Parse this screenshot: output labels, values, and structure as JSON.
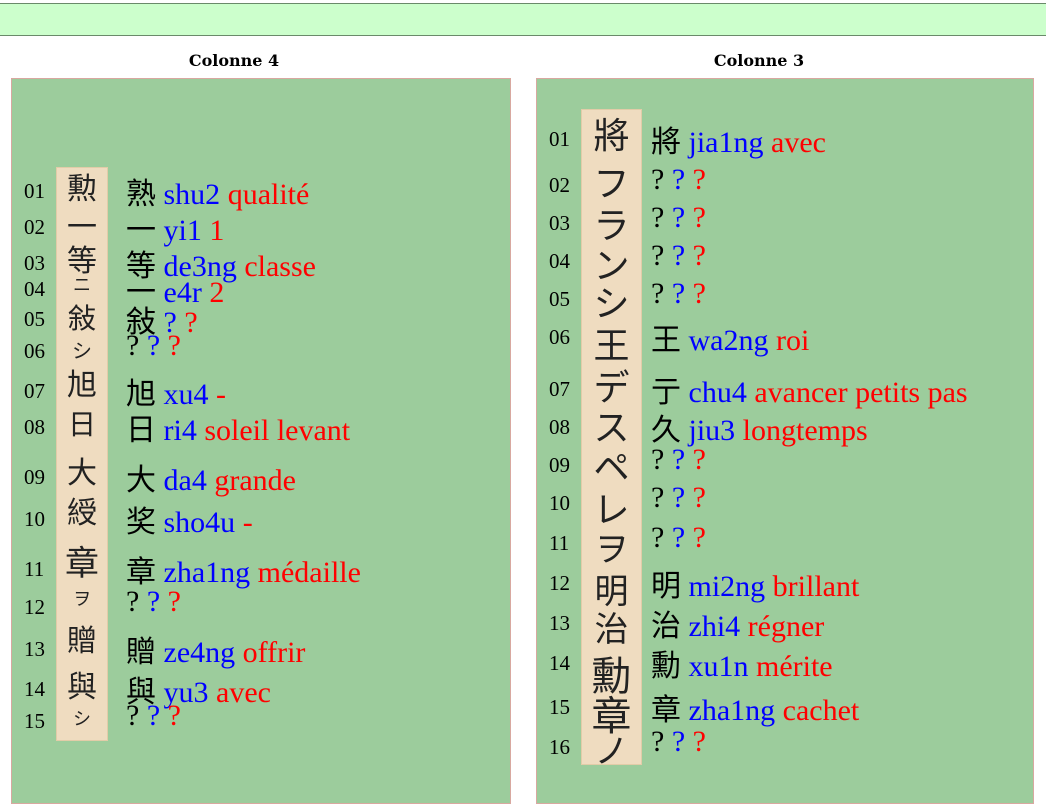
{
  "columns": [
    {
      "title": "Colonne 4",
      "rows": [
        {
          "n": "01",
          "glyph": "勲",
          "han": "熟",
          "pin": "shu2",
          "fr": "qualité"
        },
        {
          "n": "02",
          "glyph": "一",
          "han": "一",
          "pin": "yi1",
          "fr": "1"
        },
        {
          "n": "03",
          "glyph": "等",
          "han": "等",
          "pin": "de3ng",
          "fr": "classe"
        },
        {
          "n": "04",
          "glyph": "ニ",
          "han": "一",
          "pin": "e4r",
          "fr": "2"
        },
        {
          "n": "05",
          "glyph": "敍",
          "han": "敍",
          "pin": "?",
          "fr": "?"
        },
        {
          "n": "06",
          "glyph": "シ",
          "han": "?",
          "pin": "?",
          "fr": "?"
        },
        {
          "n": "07",
          "glyph": "旭",
          "han": "旭",
          "pin": "xu4",
          "fr": "-"
        },
        {
          "n": "08",
          "glyph": "日",
          "han": "日",
          "pin": "ri4",
          "fr": "soleil levant"
        },
        {
          "n": "09",
          "glyph": "大",
          "han": "大",
          "pin": "da4",
          "fr": "grande"
        },
        {
          "n": "10",
          "glyph": "綬",
          "han": "奖",
          "pin": "sho4u",
          "fr": "-"
        },
        {
          "n": "11",
          "glyph": "章",
          "han": "章",
          "pin": "zha1ng",
          "fr": "médaille"
        },
        {
          "n": "12",
          "glyph": "ヲ",
          "han": "?",
          "pin": "?",
          "fr": "?"
        },
        {
          "n": "13",
          "glyph": "贈",
          "han": "贈",
          "pin": "ze4ng",
          "fr": "offrir"
        },
        {
          "n": "14",
          "glyph": "與",
          "han": "與",
          "pin": "yu3",
          "fr": "avec"
        },
        {
          "n": "15",
          "glyph": "シ",
          "han": "?",
          "pin": "?",
          "fr": "?"
        }
      ]
    },
    {
      "title": "Colonne 3",
      "rows": [
        {
          "n": "01",
          "glyph": "將",
          "han": "將",
          "pin": "jia1ng",
          "fr": "avec"
        },
        {
          "n": "02",
          "glyph": "フ",
          "han": "?",
          "pin": "?",
          "fr": "?"
        },
        {
          "n": "03",
          "glyph": "ラ",
          "han": "?",
          "pin": "?",
          "fr": "?"
        },
        {
          "n": "04",
          "glyph": "ン",
          "han": "?",
          "pin": "?",
          "fr": "?"
        },
        {
          "n": "05",
          "glyph": "シ",
          "han": "?",
          "pin": "?",
          "fr": "?"
        },
        {
          "n": "06",
          "glyph": "王",
          "han": "王",
          "pin": "wa2ng",
          "fr": "roi"
        },
        {
          "n": "07",
          "glyph": "デ",
          "han": "亍",
          "pin": "chu4",
          "fr": "avancer petits pas"
        },
        {
          "n": "08",
          "glyph": "ス",
          "han": "久",
          "pin": "jiu3",
          "fr": "longtemps"
        },
        {
          "n": "09",
          "glyph": "ペ",
          "han": "?",
          "pin": "?",
          "fr": "?"
        },
        {
          "n": "10",
          "glyph": "レ",
          "han": "?",
          "pin": "?",
          "fr": "?"
        },
        {
          "n": "11",
          "glyph": "ヲ",
          "han": "?",
          "pin": "?",
          "fr": "?"
        },
        {
          "n": "12",
          "glyph": "明",
          "han": "明",
          "pin": "mi2ng",
          "fr": "brillant"
        },
        {
          "n": "13",
          "glyph": "治",
          "han": "治",
          "pin": "zhi4",
          "fr": "régner"
        },
        {
          "n": "14",
          "glyph": "勳",
          "han": "勳",
          "pin": "xu1n",
          "fr": "mérite"
        },
        {
          "n": "15",
          "glyph": "章",
          "han": "章",
          "pin": "zha1ng",
          "fr": "cachet"
        },
        {
          "n": "16",
          "glyph": "ノ",
          "han": "?",
          "pin": "?",
          "fr": "?"
        }
      ]
    }
  ]
}
